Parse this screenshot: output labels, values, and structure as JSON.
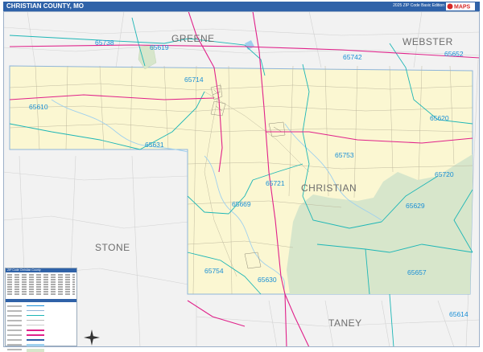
{
  "header": {
    "title": "CHRISTIAN COUNTY, MO",
    "edition": "2025 ZIP Code Basic Edition",
    "logo_text": "MAPS",
    "bar_color": "#2f62a8"
  },
  "counties": {
    "greene": "GREENE",
    "webster": "WEBSTER",
    "christian": "CHRISTIAN",
    "stone": "STONE",
    "taney": "TANEY"
  },
  "zips": {
    "z65738": "65738",
    "z65619": "65619",
    "z65742": "65742",
    "z65652": "65652",
    "z65714": "65714",
    "z65610": "65610",
    "z65620": "65620",
    "z65631": "65631",
    "z65753": "65753",
    "z65720": "65720",
    "z65721": "65721",
    "z65629": "65629",
    "z65669": "65669",
    "z65657": "65657",
    "z65754": "65754",
    "z65630": "65630",
    "z65614": "65614"
  },
  "legend": {
    "header": "ZIP Code Christian County",
    "icon": "map-legend"
  },
  "colors": {
    "county_fill": "#fbf7d2",
    "forest_fill": "#d7e6cb",
    "zip_label": "#1a8fd6",
    "zip_boundary": "#1db6b6",
    "highway": "#e0218a",
    "water": "#9fd0ee"
  }
}
